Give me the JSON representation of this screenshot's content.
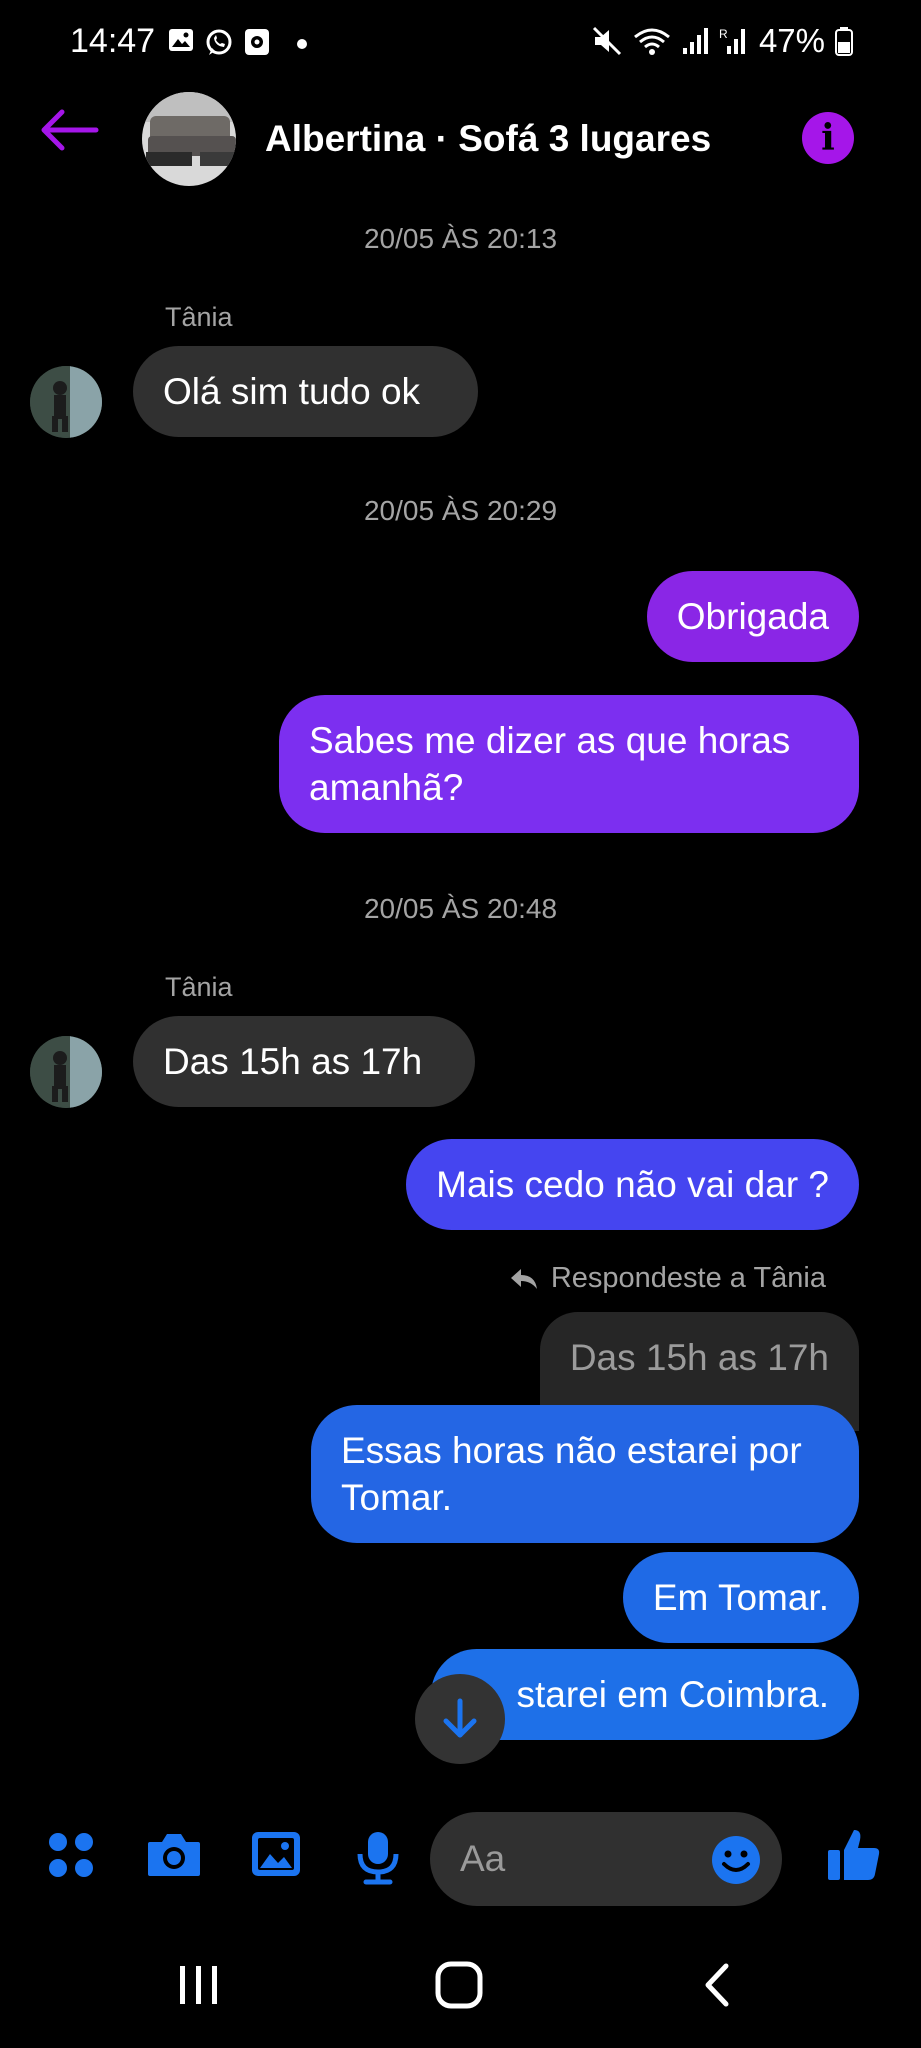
{
  "status_bar": {
    "time": "14:47",
    "battery": "47%",
    "icons": [
      "gallery-icon",
      "whatsapp-icon",
      "notification-icon",
      "dot-icon",
      "mute-icon",
      "wifi-icon",
      "signal-icon",
      "signal-roaming-icon",
      "battery-icon"
    ]
  },
  "header": {
    "title": "Albertina · Sofá 3 lugares",
    "back_icon": "arrow-left-icon",
    "info_icon": "info-icon",
    "accent_color": "#a516e9"
  },
  "messages": [
    {
      "type": "timestamp",
      "text": "20/05 ÀS 20:13"
    },
    {
      "type": "sender",
      "text": "Tânia"
    },
    {
      "type": "incoming",
      "text": "Olá sim tudo ok"
    },
    {
      "type": "timestamp",
      "text": "20/05 ÀS 20:29"
    },
    {
      "type": "outgoing",
      "text": "Obrigada",
      "color": "#8a26e6"
    },
    {
      "type": "outgoing",
      "lines": [
        "Sabes me dizer as que horas",
        "amanhã?"
      ],
      "color": "#7c2ff0"
    },
    {
      "type": "timestamp",
      "text": "20/05 ÀS 20:48"
    },
    {
      "type": "sender",
      "text": "Tânia"
    },
    {
      "type": "incoming",
      "text": "Das 15h as 17h"
    },
    {
      "type": "outgoing",
      "text": "Mais cedo não vai dar ?",
      "color": "#4545f0"
    },
    {
      "type": "reply_label",
      "text": "Respondeste a Tânia"
    },
    {
      "type": "quoted",
      "text": "Das 15h as 17h"
    },
    {
      "type": "outgoing",
      "lines": [
        "Essas horas não estarei por",
        "Tomar."
      ],
      "color": "#2466e4"
    },
    {
      "type": "outgoing",
      "text": "Em Tomar.",
      "color": "#1f6ae6"
    },
    {
      "type": "outgoing",
      "text": "Estarei em Coimbra.",
      "visible_text": "starei em Coimbra.",
      "color": "#1e70e8"
    }
  ],
  "composer": {
    "placeholder": "Aa",
    "icons": [
      "apps-icon",
      "camera-icon",
      "image-icon",
      "microphone-icon",
      "emoji-icon",
      "thumbs-up-icon"
    ],
    "icon_color": "#1b74f0"
  },
  "nav_bar": {
    "icons": [
      "recents-icon",
      "home-icon",
      "back-icon"
    ]
  }
}
